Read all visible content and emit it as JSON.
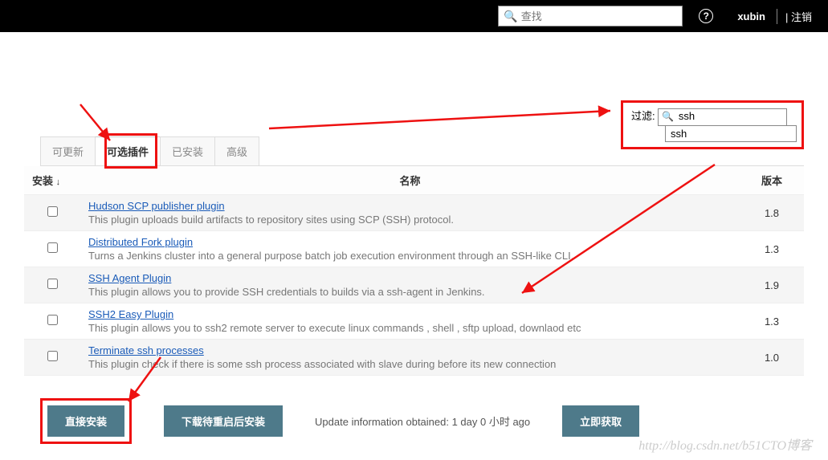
{
  "topbar": {
    "search_placeholder": "查找",
    "help": "?",
    "user": "xubin",
    "logout": "注销"
  },
  "filter": {
    "label": "过滤:",
    "value": "ssh",
    "suggestion": "ssh"
  },
  "tabs": {
    "updatable": "可更新",
    "available": "可选插件",
    "installed": "已安装",
    "advanced": "高级"
  },
  "table": {
    "header_install": "安装",
    "header_name": "名称",
    "header_version": "版本",
    "rows": [
      {
        "name": "Hudson SCP publisher plugin",
        "desc": "This plugin uploads build artifacts to repository sites using SCP (SSH) protocol.",
        "version": "1.8"
      },
      {
        "name": "Distributed Fork plugin",
        "desc": "Turns a Jenkins cluster into a general purpose batch job execution environment through an SSH-like CLI.",
        "version": "1.3"
      },
      {
        "name": "SSH Agent Plugin",
        "desc": "This plugin allows you to provide SSH credentials to builds via a ssh-agent in Jenkins.",
        "version": "1.9"
      },
      {
        "name": "SSH2 Easy Plugin",
        "desc": "This plugin allows you to ssh2 remote server to execute linux commands , shell , sftp upload, downlaod etc",
        "version": "1.3"
      },
      {
        "name": "Terminate ssh processes",
        "desc": "This plugin check if there is some ssh process associated with slave during before its new connection",
        "version": "1.0"
      }
    ]
  },
  "buttons": {
    "install_now": "直接安装",
    "download_restart": "下载待重启后安装",
    "check_now": "立即获取"
  },
  "update_info": "Update information obtained: 1 day 0 小时 ago",
  "watermark": "http://blog.csdn.net/b51CTO博客"
}
